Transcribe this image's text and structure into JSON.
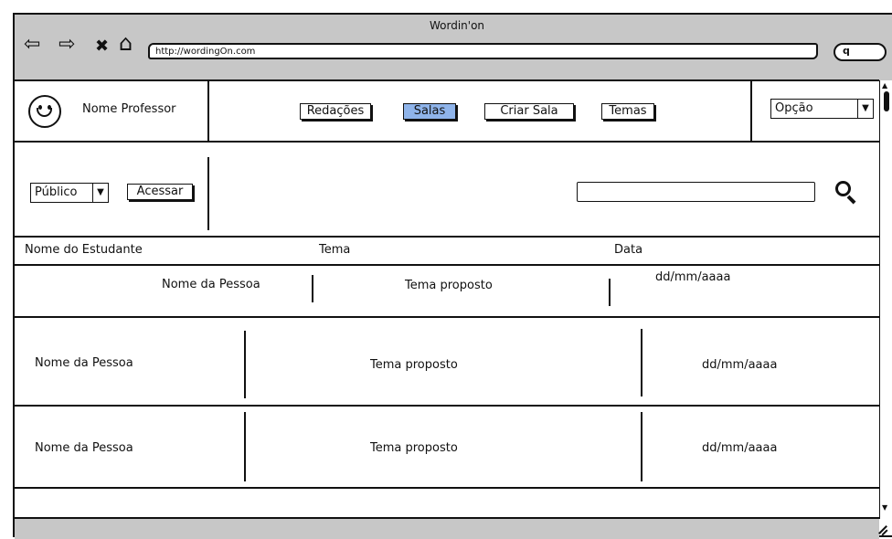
{
  "window": {
    "title": "Wordin'on",
    "url": "http://wordingOn.com"
  },
  "browser_nav": {
    "back_glyph": "⇦",
    "forward_glyph": "⇨",
    "stop_glyph": "✖",
    "home_glyph": "⌂",
    "search_glyph": "q"
  },
  "header": {
    "avatar_glyph": "☺",
    "professor_name": "Nome Professor",
    "nav": [
      {
        "label": "Redações"
      },
      {
        "label": "Salas"
      },
      {
        "label": "Criar Sala"
      },
      {
        "label": "Temas"
      }
    ],
    "active_nav": "Salas",
    "options_select": "Opção"
  },
  "toolbar": {
    "visibility_select": "Público",
    "access_button": "Acessar",
    "search_value": "",
    "search_icon": "magnifier-icon"
  },
  "table": {
    "columns": [
      "Nome do Estudante",
      "Tema",
      "Data"
    ],
    "rows": [
      {
        "name": "Nome da Pessoa",
        "theme": "Tema proposto",
        "date": "dd/mm/aaaa"
      },
      {
        "name": "Nome da Pessoa",
        "theme": "Tema proposto",
        "date": "dd/mm/aaaa"
      },
      {
        "name": "Nome da Pessoa",
        "theme": "Tema proposto",
        "date": "dd/mm/aaaa"
      }
    ]
  },
  "colors": {
    "chrome": "#c7c7c7",
    "active_button": "#8fb4ea",
    "ink": "#111111"
  }
}
